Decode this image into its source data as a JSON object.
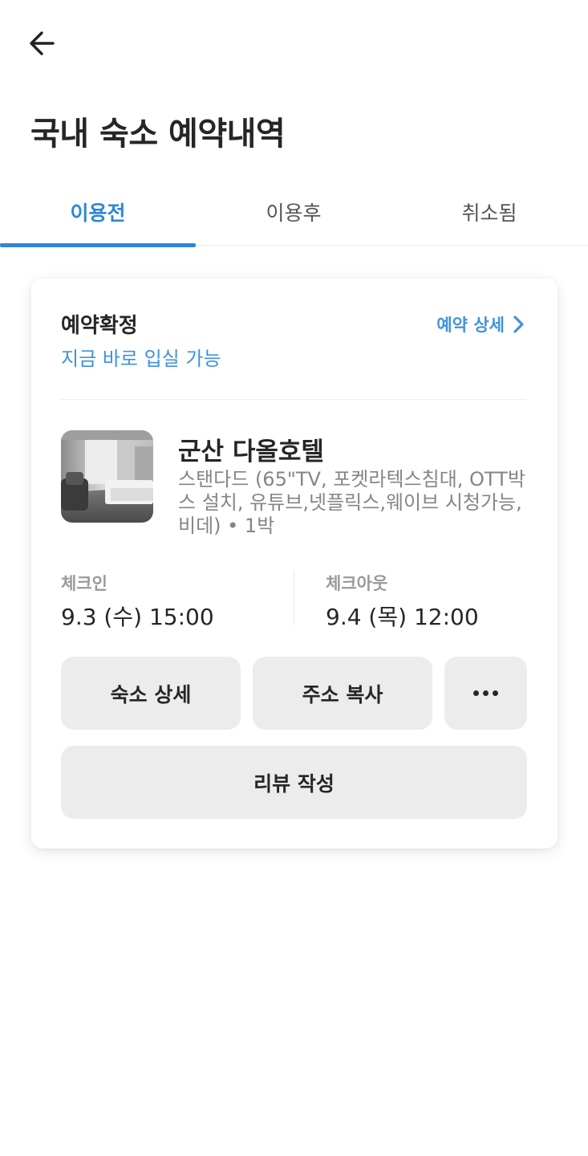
{
  "header": {
    "back_icon": "arrow-left-icon",
    "title": "국내 숙소 예약내역"
  },
  "tabs": [
    {
      "label": "이용전",
      "active": true
    },
    {
      "label": "이용후",
      "active": false
    },
    {
      "label": "취소됨",
      "active": false
    }
  ],
  "colors": {
    "accent": "#2f86d6",
    "button_bg": "#ececec"
  },
  "reservation": {
    "status": "예약확정",
    "substatus": "지금 바로 입실 가능",
    "detail_link": "예약 상세",
    "detail_icon": "chevron-right-icon",
    "hotel_name": "군산 다올호텔",
    "room_info": "스탠다드 (65\"TV, 포켓라텍스침대, OTT박스 설치, 유튜브,넷플릭스,웨이브 시청가능, 비데) • 1박",
    "checkin_label": "체크인",
    "checkin_value": "9.3 (수) 15:00",
    "checkout_label": "체크아웃",
    "checkout_value": "9.4 (목) 12:00",
    "buttons": {
      "hotel_detail": "숙소 상세",
      "copy_address": "주소 복사",
      "more_icon": "more-dots-icon",
      "write_review": "리뷰 작성"
    }
  }
}
